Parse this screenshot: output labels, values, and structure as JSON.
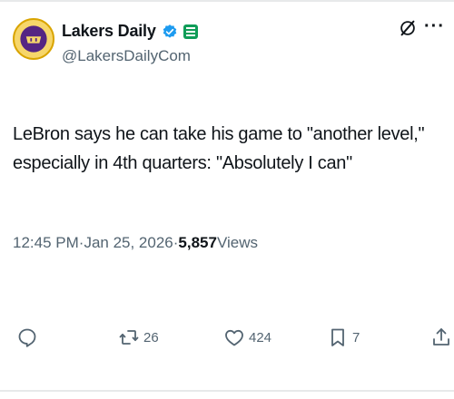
{
  "author": {
    "display_name": "Lakers Daily",
    "handle": "@LakersDailyCom"
  },
  "tweet": {
    "text": "LeBron says he can take his game to \"another level,\" especially in 4th quarters: \"Absolutely I can\"",
    "time": "12:45 PM",
    "date": "Jan 25, 2026",
    "separator": " · ",
    "views_count": "5,857",
    "views_label": " Views"
  },
  "actions": {
    "reply_count": "",
    "repost_count": "26",
    "like_count": "424",
    "bookmark_count": "7"
  },
  "colors": {
    "verified": "#1d9bf0",
    "affiliate": "#0f9d58",
    "secondary_text": "#536471",
    "avatar_gold": "#f6d66b",
    "avatar_purple": "#552583"
  },
  "icons": [
    "verified-badge-icon",
    "affiliate-badge-icon",
    "grok-icon",
    "more-icon",
    "reply-icon",
    "repost-icon",
    "like-icon",
    "bookmark-icon",
    "share-icon"
  ]
}
